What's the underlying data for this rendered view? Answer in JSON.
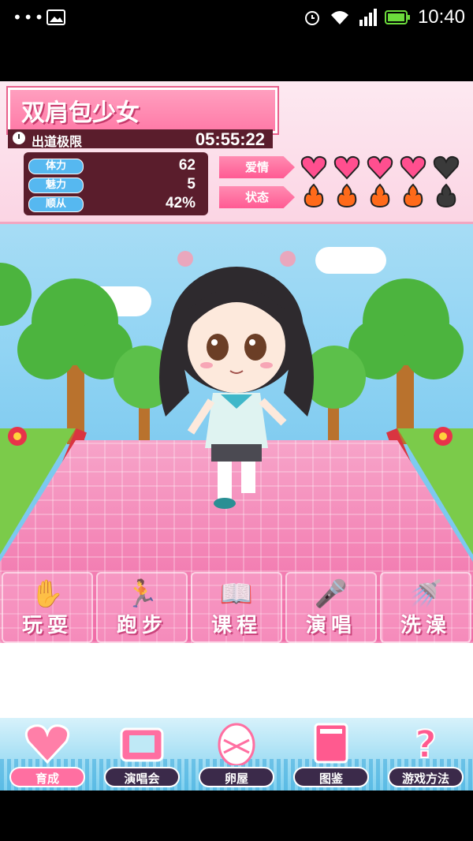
{
  "status_bar": {
    "left": "•••",
    "time": "10:40"
  },
  "hud": {
    "title": "双肩包少女",
    "deadline_label": "出道极限",
    "deadline_value": "05:55:22",
    "stats": [
      {
        "label": "体力",
        "value": "62"
      },
      {
        "label": "魅力",
        "value": "5"
      },
      {
        "label": "顺从",
        "value": "42%"
      }
    ],
    "affection_label": "爱情",
    "affection_filled": 4,
    "affection_total": 5,
    "state_label": "状态",
    "state_filled": 4,
    "state_total": 5
  },
  "actions": [
    {
      "label": "玩耍",
      "icon": "hand-icon"
    },
    {
      "label": "跑步",
      "icon": "runner-icon"
    },
    {
      "label": "课程",
      "icon": "book-icon"
    },
    {
      "label": "演唱",
      "icon": "microphone-icon"
    },
    {
      "label": "洗澡",
      "icon": "shower-icon"
    }
  ],
  "bottom_nav": [
    {
      "label": "育成",
      "icon": "heart-icon",
      "active": true
    },
    {
      "label": "演唱会",
      "icon": "stage-icon",
      "active": false
    },
    {
      "label": "卵屋",
      "icon": "egg-icon",
      "active": false
    },
    {
      "label": "图鉴",
      "icon": "album-icon",
      "active": false
    },
    {
      "label": "游戏方法",
      "icon": "question-icon",
      "active": false
    }
  ],
  "colors": {
    "accent_pink": "#ff6fa1",
    "heart_filled": "#ff4f8f",
    "flame": "#ff6a1a",
    "dark_panel": "#5a1d2c"
  }
}
